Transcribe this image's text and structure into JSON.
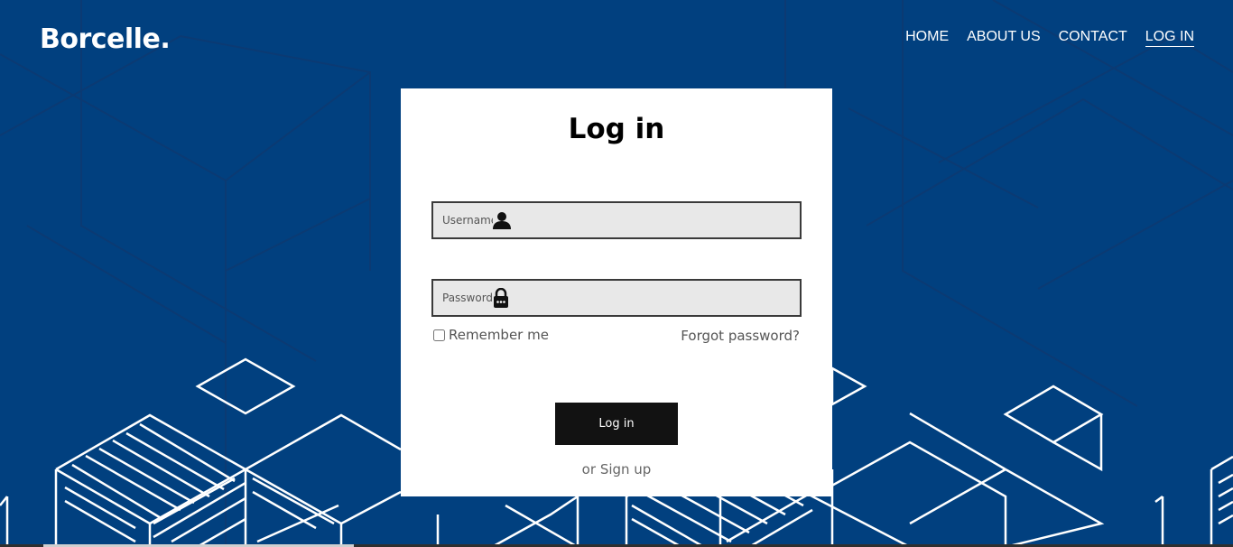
{
  "brand": {
    "logo": "Borcelle."
  },
  "nav": {
    "items": [
      {
        "label": "HOME"
      },
      {
        "label": "ABOUT US"
      },
      {
        "label": "CONTACT"
      },
      {
        "label": "LOG IN",
        "active": true
      }
    ]
  },
  "login": {
    "title": "Log in",
    "username": {
      "placeholder": "Username",
      "value": "",
      "icon": "user-icon"
    },
    "password": {
      "placeholder": "Password",
      "value": "",
      "icon": "lock-icon"
    },
    "remember_label": "Remember me",
    "remember_checked": false,
    "forgot_label": "Forgot password?",
    "submit_label": "Log in",
    "signup_prefix": "or",
    "signup_label": "Sign up"
  },
  "colors": {
    "background": "#01407f",
    "card": "#ffffff",
    "field": "#e8e8e8",
    "button": "#121212",
    "pattern_lines": "#ffffff"
  }
}
